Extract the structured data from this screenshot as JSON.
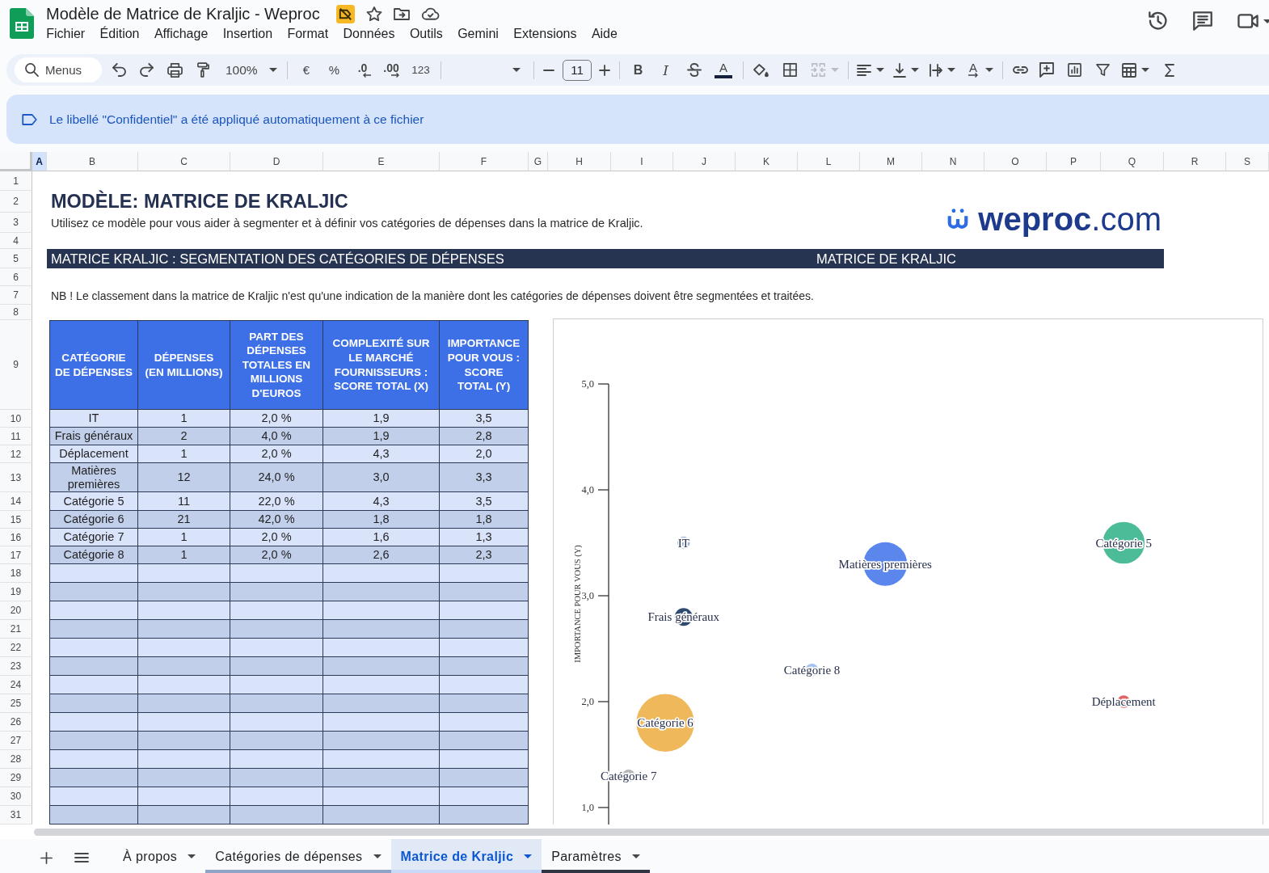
{
  "window": {
    "title": "Modèle de Matrice de Kraljic - Weproc"
  },
  "menu": [
    "Fichier",
    "Édition",
    "Affichage",
    "Insertion",
    "Format",
    "Données",
    "Outils",
    "Gemini",
    "Extensions",
    "Aide"
  ],
  "toolbar": {
    "search": {
      "placeholder": "Menus"
    },
    "zoom": "100%",
    "currency": "€",
    "percent": "%",
    "decrease_decimals": ".0",
    "increase_decimals": ".00",
    "number_formats": "123",
    "font_size": {
      "value": "11"
    },
    "bold": "B",
    "italic": "I",
    "text_color": "A",
    "text_rotation": "A",
    "merge": {
      "disabled": true
    }
  },
  "banner": {
    "text": "Le libellé \"Confidentiel\" a été appliqué automatiquement à ce fichier"
  },
  "column_headers": [
    {
      "label": "A",
      "selected": true
    },
    {
      "label": "B",
      "selected": false
    },
    {
      "label": "C",
      "selected": false
    },
    {
      "label": "D",
      "selected": false
    },
    {
      "label": "E",
      "selected": false
    },
    {
      "label": "F",
      "selected": false
    },
    {
      "label": "G",
      "selected": false
    },
    {
      "label": "H",
      "selected": false
    },
    {
      "label": "I",
      "selected": false
    },
    {
      "label": "J",
      "selected": false
    },
    {
      "label": "K",
      "selected": false
    },
    {
      "label": "L",
      "selected": false
    },
    {
      "label": "M",
      "selected": false
    },
    {
      "label": "N",
      "selected": false
    },
    {
      "label": "O",
      "selected": false
    },
    {
      "label": "P",
      "selected": false
    },
    {
      "label": "Q",
      "selected": false
    },
    {
      "label": "R",
      "selected": false
    },
    {
      "label": "S",
      "selected": false
    }
  ],
  "row_numbers": [
    "1",
    "2",
    "3",
    "4",
    "5",
    "6",
    "7",
    "8",
    "9",
    "10",
    "11",
    "12",
    "13",
    "14",
    "15",
    "16",
    "17",
    "18",
    "19",
    "20",
    "21",
    "22",
    "23",
    "24",
    "25",
    "26",
    "27",
    "28",
    "29",
    "30",
    "31"
  ],
  "sheet": {
    "title": "MODÈLE: MATRICE DE KRALJIC",
    "subtitle": "Utilisez ce modèle pour vous aider à segmenter et à définir vos catégories de dépenses dans la matrice de Kraljic.",
    "logo": "**weproc**.com",
    "section_bar": [
      "MATRICE KRALJIC : SEGMENTATION DES CATÉGORIES DE DÉPENSES",
      "MATRICE DE KRALJIC"
    ],
    "note": "NB ! Le classement dans la matrice de Kraljic n'est qu'une indication de la manière dont les catégories de dépenses doivent être segmentées et traitées."
  },
  "table": {
    "columns": [
      "CATÉGORIE\nDE DÉPENSES",
      "DÉPENSES\n(EN MILLIONS)",
      "PART DES\nDÉPENSES\nTOTALES EN\nMILLIONS\nD'EUROS",
      "COMPLEXITÉ SUR\nLE MARCHÉ\nFOURNISSEURS :\nSCORE TOTAL (X)",
      "IMPORTANCE\nPOUR VOUS :\nSCORE\nTOTAL (Y)"
    ],
    "rows": [
      [
        "IT",
        "1",
        "2,0 %",
        "1,9",
        "3,5"
      ],
      [
        "Frais généraux",
        "2",
        "4,0 %",
        "1,9",
        "2,8"
      ],
      [
        "Déplacement",
        "1",
        "2,0 %",
        "4,3",
        "2,0"
      ],
      [
        "Matières premières",
        "12",
        "24,0 %",
        "3,0",
        "3,3"
      ],
      [
        "Catégorie 5",
        "11",
        "22,0 %",
        "4,3",
        "3,5"
      ],
      [
        "Catégorie 6",
        "21",
        "42,0 %",
        "1,8",
        "1,8"
      ],
      [
        "Catégorie 7",
        "1",
        "2,0 %",
        "1,6",
        "1,3"
      ],
      [
        "Catégorie 8",
        "1",
        "2,0 %",
        "2,6",
        "2,3"
      ]
    ]
  },
  "chart": {
    "y_axis_title": "IMPORTANCE POUR VOUS (Y)",
    "y_ticks": [
      "5,0",
      "4,0",
      "3,0",
      "2,0",
      "1,0"
    ],
    "points": [
      {
        "label": "IT",
        "color": "#9fb4dd"
      },
      {
        "label": "Frais généraux",
        "color": "#2e4a6e"
      },
      {
        "label": "Déplacement",
        "color": "#e06666"
      },
      {
        "label": "Matières premières",
        "color": "#5b87ec"
      },
      {
        "label": "Catégorie 5",
        "color": "#4cbb97"
      },
      {
        "label": "Catégorie 6",
        "color": "#efb85a"
      },
      {
        "label": "Catégorie 7",
        "color": "#b7b7b7"
      },
      {
        "label": "Catégorie 8",
        "color": "#a4c2f4"
      }
    ]
  },
  "sheet_tabs": [
    {
      "label": "À propos",
      "selected": false
    },
    {
      "label": "Catégories de dépenses",
      "selected": false,
      "color": "#8fa3c8"
    },
    {
      "label": "Matrice de Kraljic",
      "selected": true,
      "color": "#c9daf8"
    },
    {
      "label": "Paramètres",
      "selected": false,
      "color": "#2f3542"
    }
  ]
}
